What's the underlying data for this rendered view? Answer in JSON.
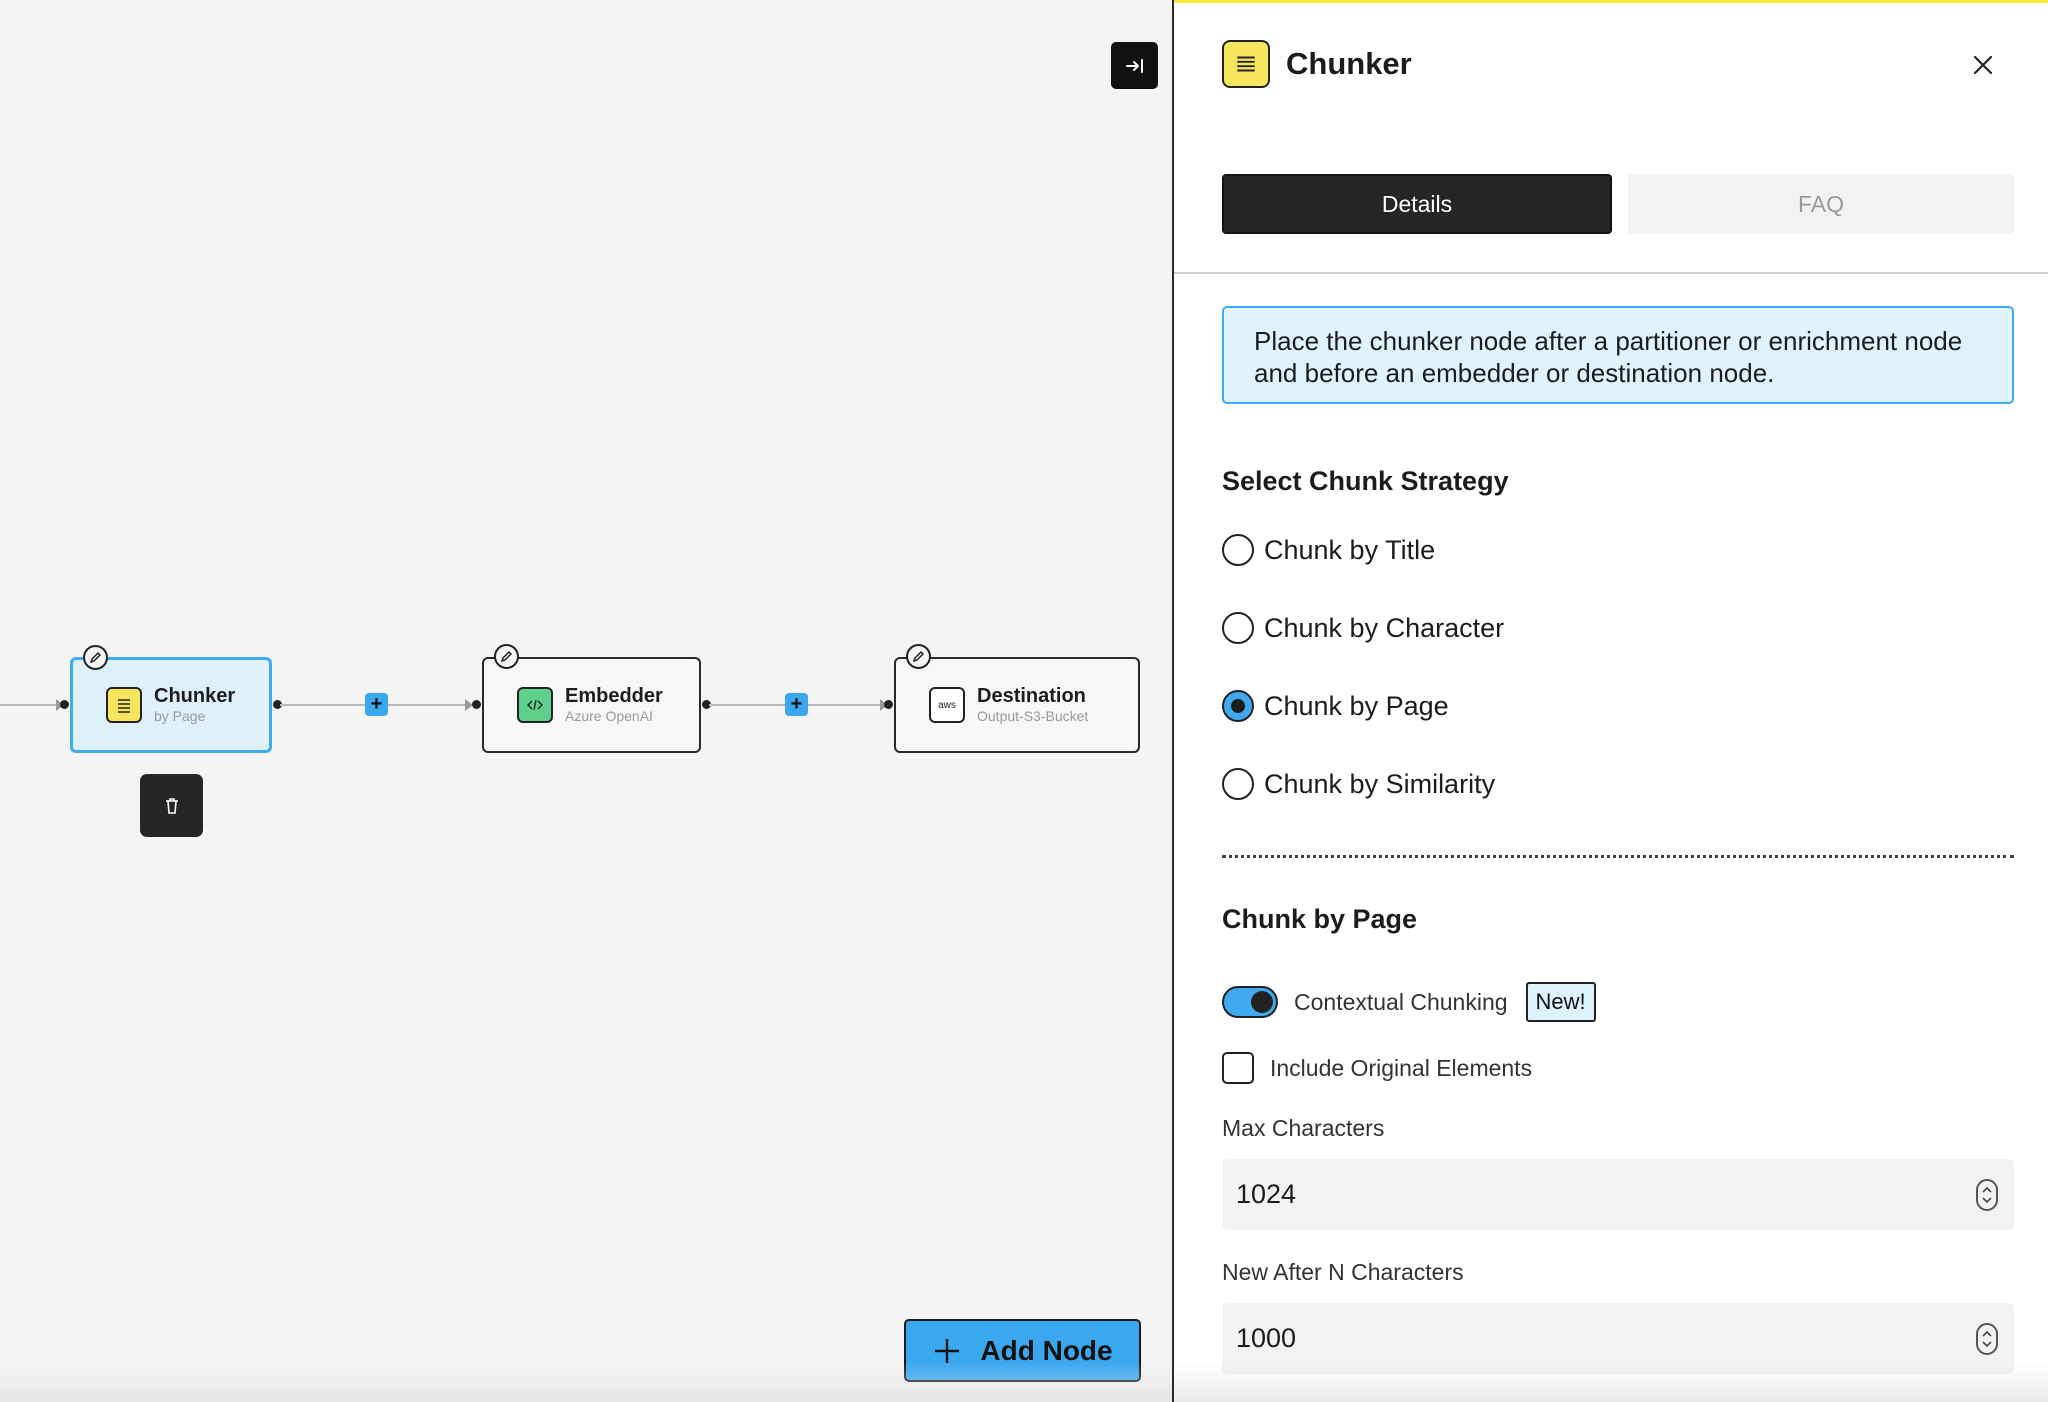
{
  "canvas": {
    "nodes": [
      {
        "title": "Chunker",
        "subtitle": "by Page"
      },
      {
        "title": "Embedder",
        "subtitle": "Azure OpenAI"
      },
      {
        "title": "Destination",
        "subtitle": "Output-S3-Bucket",
        "icon_text": "aws"
      }
    ],
    "add_node_label": "Add Node",
    "plus_glyph": "+"
  },
  "panel": {
    "title": "Chunker",
    "tabs": [
      {
        "label": "Details",
        "active": true
      },
      {
        "label": "FAQ",
        "active": false
      }
    ],
    "info_text": "Place the chunker node after a partitioner or enrichment node and before an embedder or destination node.",
    "strategy_heading": "Select Chunk Strategy",
    "strategies": [
      {
        "label": "Chunk by Title",
        "checked": false
      },
      {
        "label": "Chunk by Character",
        "checked": false
      },
      {
        "label": "Chunk by Page",
        "checked": true
      },
      {
        "label": "Chunk by Similarity",
        "checked": false
      }
    ],
    "options_heading": "Chunk by Page",
    "contextual_chunking": {
      "label": "Contextual Chunking",
      "enabled": true,
      "badge": "New!"
    },
    "include_original": {
      "label": "Include Original Elements",
      "checked": false
    },
    "max_characters": {
      "label": "Max Characters",
      "value": "1024"
    },
    "new_after": {
      "label": "New After N Characters",
      "value": "1000"
    }
  },
  "colors": {
    "accent_blue": "#41a9ef",
    "chunker_yellow": "#f7e65d",
    "embedder_green": "#5fd08b",
    "dark": "#262626"
  }
}
